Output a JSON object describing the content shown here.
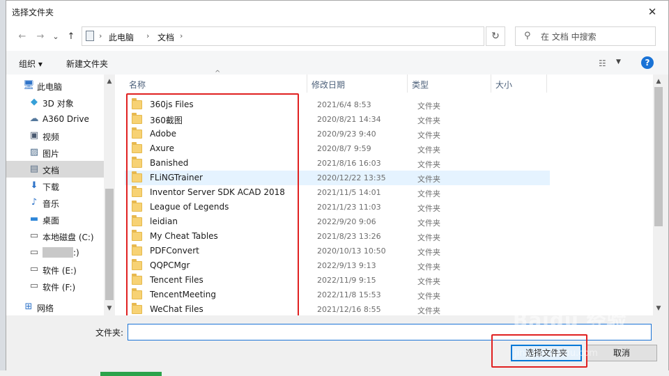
{
  "window": {
    "title": "选择文件夹",
    "close_glyph": "✕"
  },
  "navigation": {
    "back_glyph": "←",
    "forward_glyph": "→",
    "dropdown_glyph": "⌄",
    "up_glyph": "↑",
    "breadcrumb": [
      "此电脑",
      "文档"
    ],
    "crumb_separator": "›",
    "refresh_glyph": "↻",
    "search_placeholder": "在 文档 中搜索",
    "search_icon_glyph": "⚲"
  },
  "toolbar": {
    "organize": "组织 ▾",
    "new_folder": "新建文件夹",
    "view_glyph": "☷",
    "view_dropdown": "▼",
    "help": "?"
  },
  "sidebar": {
    "items": [
      {
        "label": "此电脑",
        "icon": "computer-icon",
        "glyph": "🖥",
        "color": "#2e73c8"
      },
      {
        "label": "3D 对象",
        "icon": "cube-icon",
        "glyph": "◆",
        "color": "#36a0d8"
      },
      {
        "label": "A360 Drive",
        "icon": "cloud-drive-icon",
        "glyph": "☁",
        "color": "#55789c"
      },
      {
        "label": "视频",
        "icon": "video-icon",
        "glyph": "▣",
        "color": "#4a5a70"
      },
      {
        "label": "图片",
        "icon": "image-icon",
        "glyph": "▨",
        "color": "#4a6a8a"
      },
      {
        "label": "文档",
        "icon": "document-icon",
        "glyph": "▤",
        "color": "#5a6f86"
      },
      {
        "label": "下载",
        "icon": "download-icon",
        "glyph": "⬇",
        "color": "#2e73c8"
      },
      {
        "label": "音乐",
        "icon": "music-icon",
        "glyph": "♪",
        "color": "#2e73c8"
      },
      {
        "label": "桌面",
        "icon": "desktop-icon",
        "glyph": "▬",
        "color": "#2e86d8"
      },
      {
        "label": "本地磁盘 (C:)",
        "icon": "drive-icon",
        "glyph": "▭",
        "color": "#555555"
      },
      {
        "label": ":)",
        "icon": "drive-icon",
        "glyph": "▭",
        "color": "#555555"
      },
      {
        "label": "软件 (E:)",
        "icon": "drive-icon",
        "glyph": "▭",
        "color": "#555555"
      },
      {
        "label": "软件 (F:)",
        "icon": "drive-icon",
        "glyph": "▭",
        "color": "#555555"
      },
      {
        "label": "网络",
        "icon": "network-icon",
        "glyph": "⊞",
        "color": "#2e73c8"
      }
    ],
    "selected_index": 5,
    "scroll_up": "▲",
    "scroll_down": "▼"
  },
  "columns": {
    "name": "名称",
    "date": "修改日期",
    "type": "类型",
    "size": "大小",
    "sort_glyph": "^"
  },
  "files": [
    {
      "name": "360js Files",
      "date": "2021/6/4 8:53",
      "type": "文件夹"
    },
    {
      "name": "360截图",
      "date": "2020/8/21 14:34",
      "type": "文件夹"
    },
    {
      "name": "Adobe",
      "date": "2020/9/23 9:40",
      "type": "文件夹"
    },
    {
      "name": "Axure",
      "date": "2020/8/7 9:59",
      "type": "文件夹"
    },
    {
      "name": "Banished",
      "date": "2021/8/16 16:03",
      "type": "文件夹"
    },
    {
      "name": "FLiNGTrainer",
      "date": "2020/12/22 13:35",
      "type": "文件夹"
    },
    {
      "name": "Inventor Server SDK ACAD 2018",
      "date": "2021/11/5 14:01",
      "type": "文件夹"
    },
    {
      "name": "League of Legends",
      "date": "2021/1/23 11:03",
      "type": "文件夹"
    },
    {
      "name": "leidian",
      "date": "2022/9/20 9:06",
      "type": "文件夹"
    },
    {
      "name": "My Cheat Tables",
      "date": "2021/8/23 13:26",
      "type": "文件夹"
    },
    {
      "name": "PDFConvert",
      "date": "2020/10/13 10:50",
      "type": "文件夹"
    },
    {
      "name": "QQPCMgr",
      "date": "2022/9/13 9:13",
      "type": "文件夹"
    },
    {
      "name": "Tencent Files",
      "date": "2022/11/9 9:15",
      "type": "文件夹"
    },
    {
      "name": "TencentMeeting",
      "date": "2022/11/8 15:53",
      "type": "文件夹"
    },
    {
      "name": "WeChat Files",
      "date": "2021/12/16 8:55",
      "type": "文件夹"
    }
  ],
  "hovered_index": 5,
  "footer": {
    "folder_label": "文件夹:",
    "folder_value": "",
    "select_button": "选择文件夹",
    "cancel_button": "取消"
  },
  "watermark": {
    "text": "Baidu 经验",
    "sub": "jingyan.baidu.com"
  },
  "colors": {
    "accent": "#0078d7",
    "highlight_box": "#e02020",
    "folder": "#f7d274",
    "hover_row": "#e5f3ff"
  }
}
